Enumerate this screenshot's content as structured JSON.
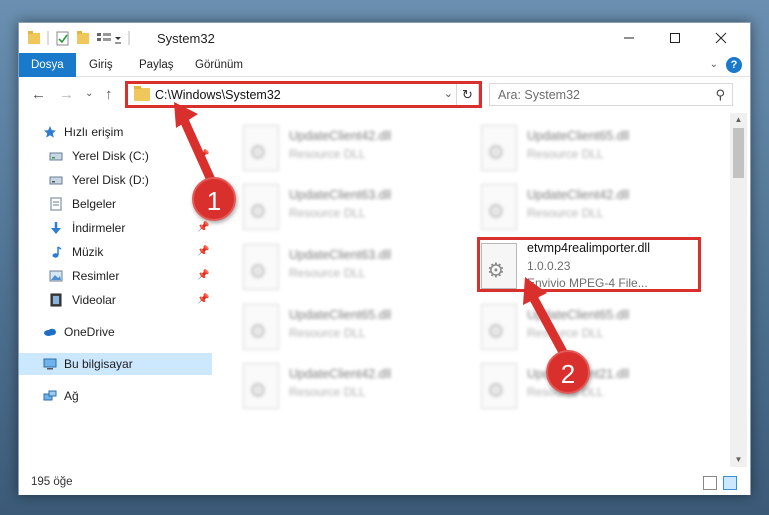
{
  "window": {
    "title": "System32"
  },
  "ribbon": {
    "tabs": [
      {
        "label": "Dosya",
        "active": true
      },
      {
        "label": "Giriş",
        "active": false
      },
      {
        "label": "Paylaş",
        "active": false
      },
      {
        "label": "Görünüm",
        "active": false
      }
    ],
    "help": "?"
  },
  "address_bar": {
    "path": "C:\\Windows\\System32",
    "refresh_icon": "refresh-icon"
  },
  "search": {
    "placeholder": "Ara: System32"
  },
  "sidebar": {
    "items": [
      {
        "label": "Hızlı erişim",
        "icon": "star-icon",
        "pinned": false
      },
      {
        "label": "Yerel Disk (C:)",
        "icon": "drive-icon",
        "pinned": true
      },
      {
        "label": "Yerel Disk (D:)",
        "icon": "drive-icon",
        "pinned": false
      },
      {
        "label": "Belgeler",
        "icon": "document-icon",
        "pinned": true
      },
      {
        "label": "İndirmeler",
        "icon": "download-icon",
        "pinned": true
      },
      {
        "label": "Müzik",
        "icon": "music-icon",
        "pinned": true
      },
      {
        "label": "Resimler",
        "icon": "pictures-icon",
        "pinned": true
      },
      {
        "label": "Videolar",
        "icon": "video-icon",
        "pinned": true
      },
      {
        "label": "OneDrive",
        "icon": "cloud-icon",
        "pinned": false
      },
      {
        "label": "Bu bilgisayar",
        "icon": "computer-icon",
        "pinned": false,
        "selected": true
      },
      {
        "label": "Ağ",
        "icon": "network-icon",
        "pinned": false
      }
    ]
  },
  "files": [
    {
      "name": "UpdateClient42.dll",
      "type": "Resource DLL"
    },
    {
      "name": "UpdateClient65.dll",
      "type": "Resource DLL"
    },
    {
      "name": "UpdateClient63.dll",
      "type": "Resource DLL"
    },
    {
      "name": "UpdateClient42.dll",
      "type": "Resource DLL"
    },
    {
      "name": "UpdateClient63.dll",
      "type": "Resource DLL"
    },
    {
      "name": "etvmp4realimporter.dll",
      "version": "1.0.0.23",
      "description": "Envivio MPEG-4 File...",
      "highlighted": true
    },
    {
      "name": "UpdateClient65.dll",
      "type": "Resource DLL"
    },
    {
      "name": "UpdateClient65.dll",
      "type": "Resource DLL"
    },
    {
      "name": "UpdateClient42.dll",
      "type": "Resource DLL"
    },
    {
      "name": "UpdateClient21.dll",
      "type": "Resource DLL"
    }
  ],
  "status": {
    "item_count": "195 öğe"
  },
  "annotations": {
    "badge1": "1",
    "badge2": "2",
    "color": "#d9302d"
  }
}
